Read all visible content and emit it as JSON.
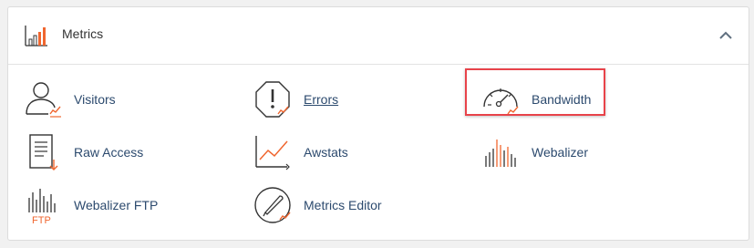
{
  "header": {
    "title": "Metrics",
    "header_icon": "bar-chart-icon",
    "collapse_icon": "chevron-up-icon"
  },
  "accent_color": "#f0662f",
  "items": [
    {
      "label": "Visitors",
      "icon": "visitors-icon"
    },
    {
      "label": "Errors",
      "icon": "errors-icon"
    },
    {
      "label": "Bandwidth",
      "icon": "bandwidth-icon"
    },
    {
      "label": "Raw Access",
      "icon": "raw-access-icon"
    },
    {
      "label": "Awstats",
      "icon": "awstats-icon"
    },
    {
      "label": "Webalizer",
      "icon": "webalizer-icon"
    },
    {
      "label": "Webalizer FTP",
      "icon": "webalizer-ftp-icon",
      "icon_text": "FTP"
    },
    {
      "label": "Metrics Editor",
      "icon": "metrics-editor-icon"
    }
  ]
}
